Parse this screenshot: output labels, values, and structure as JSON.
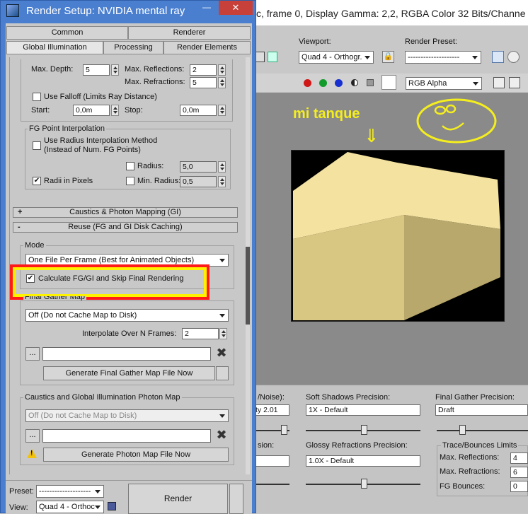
{
  "dialog": {
    "title": "Render Setup: NVIDIA mental ray",
    "minimize": "—",
    "close": "✕"
  },
  "tabs": {
    "row1": [
      "Common",
      "Renderer"
    ],
    "row2": [
      "Global Illumination",
      "Processing",
      "Render Elements"
    ]
  },
  "fg": {
    "max_depth_label": "Max. Depth:",
    "max_depth": "5",
    "max_refl_label": "Max. Reflections:",
    "max_refl": "2",
    "max_refr_label": "Max. Refractions:",
    "max_refr": "5",
    "falloff_label": "Use Falloff (Limits Ray Distance)",
    "start_label": "Start:",
    "start": "0,0m",
    "stop_label": "Stop:",
    "stop": "0,0m"
  },
  "interp": {
    "title": "FG Point Interpolation",
    "radius_method_line1": "Use Radius Interpolation Method",
    "radius_method_line2": "(Instead of Num. FG Points)",
    "radius_label": "Radius:",
    "radius": "5,0",
    "radii_pixels_label": "Radii in Pixels",
    "min_radius_label": "Min. Radius:",
    "min_radius": "0,5"
  },
  "rollouts": {
    "caustics": {
      "sign": "+",
      "label": "Caustics & Photon Mapping (GI)"
    },
    "reuse": {
      "sign": "-",
      "label": "Reuse (FG and GI Disk Caching)"
    }
  },
  "mode": {
    "title": "Mode",
    "value": "One File Per Frame (Best for Animated Objects)",
    "calc_label": "Calculate FG/GI and Skip Final Rendering",
    "calc_check": "✔"
  },
  "fgmap": {
    "title": "Final Gather Map",
    "value": "Off (Do not Cache Map to Disk)",
    "interp_label": "Interpolate Over N Frames:",
    "interp_value": "2",
    "browse": "...",
    "generate": "Generate Final Gather Map File Now"
  },
  "photon": {
    "title": "Caustics and Global Illumination Photon Map",
    "value": "Off (Do not Cache Map to Disk)",
    "browse": "...",
    "generate": "Generate Photon Map File Now",
    "warn": "!"
  },
  "bottom": {
    "preset_label": "Preset:",
    "preset_value": "--------------------",
    "view_label": "View:",
    "view_value": "Quad 4 - Orthoc",
    "render": "Render"
  },
  "frame": {
    "title": "c, frame 0, Display Gamma: 2,2, RGBA Color 32 Bits/Channe",
    "viewport_label": "Viewport:",
    "viewport_value": "Quad 4 - Orthogr.",
    "preset_label": "Render Preset:",
    "preset_value": "--------------------",
    "channel": "RGB Alpha"
  },
  "annotation": {
    "text": "mi tanque",
    "arrow": "⇓"
  },
  "lower": {
    "noise_label": "/Noise):",
    "noise_value": "ty 2.01",
    "soft_label": "Soft Shadows Precision:",
    "soft_value": "1X - Default",
    "fg_label": "Final Gather Precision:",
    "fg_value": "Draft",
    "sion_label": "sion:",
    "glossy_label": "Glossy Refractions Precision:",
    "glossy_value": "1.0X - Default",
    "trace_title": "Trace/Bounces Limits",
    "refl_label": "Max. Reflections:",
    "refl_value": "4",
    "refr_label": "Max. Refractions:",
    "refr_value": "6",
    "bounces_label": "FG Bounces:",
    "bounces_value": "0"
  },
  "colors": {
    "highlight": "#ff1a1a",
    "highlight_inner": "#fff200",
    "annotation": "#f5ee1e",
    "cube_top": "#f3e2a0",
    "cube_left": "#d8c783",
    "cube_right": "#b8a86c"
  }
}
